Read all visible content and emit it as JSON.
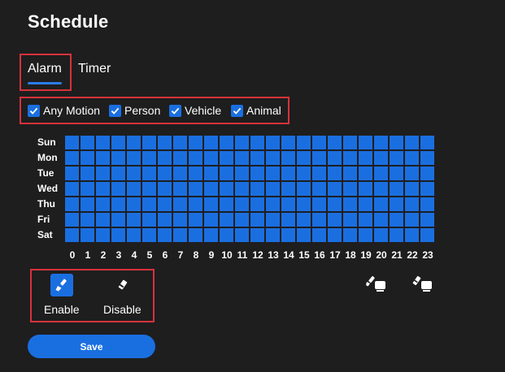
{
  "page_title": "Schedule",
  "tabs": [
    {
      "label": "Alarm",
      "active": true
    },
    {
      "label": "Timer",
      "active": false
    }
  ],
  "filters": [
    {
      "label": "Any Motion",
      "checked": true
    },
    {
      "label": "Person",
      "checked": true
    },
    {
      "label": "Vehicle",
      "checked": true
    },
    {
      "label": "Animal",
      "checked": true
    }
  ],
  "schedule": {
    "days": [
      "Sun",
      "Mon",
      "Tue",
      "Wed",
      "Thu",
      "Fri",
      "Sat"
    ],
    "hours": [
      "0",
      "1",
      "2",
      "3",
      "4",
      "5",
      "6",
      "7",
      "8",
      "9",
      "10",
      "11",
      "12",
      "13",
      "14",
      "15",
      "16",
      "17",
      "18",
      "19",
      "20",
      "21",
      "22",
      "23"
    ],
    "all_enabled": true
  },
  "tools": {
    "enable_label": "Enable",
    "disable_label": "Disable",
    "selected": "enable",
    "enable_icon": "brush-icon",
    "disable_icon": "eraser-icon"
  },
  "actions": {
    "fill_all_icon": "fill-all-icon",
    "clear_all_icon": "clear-all-icon"
  },
  "save_label": "Save",
  "colors": {
    "background": "#1e1e1f",
    "accent": "#1a6fe0",
    "highlight": "#d6323a"
  }
}
